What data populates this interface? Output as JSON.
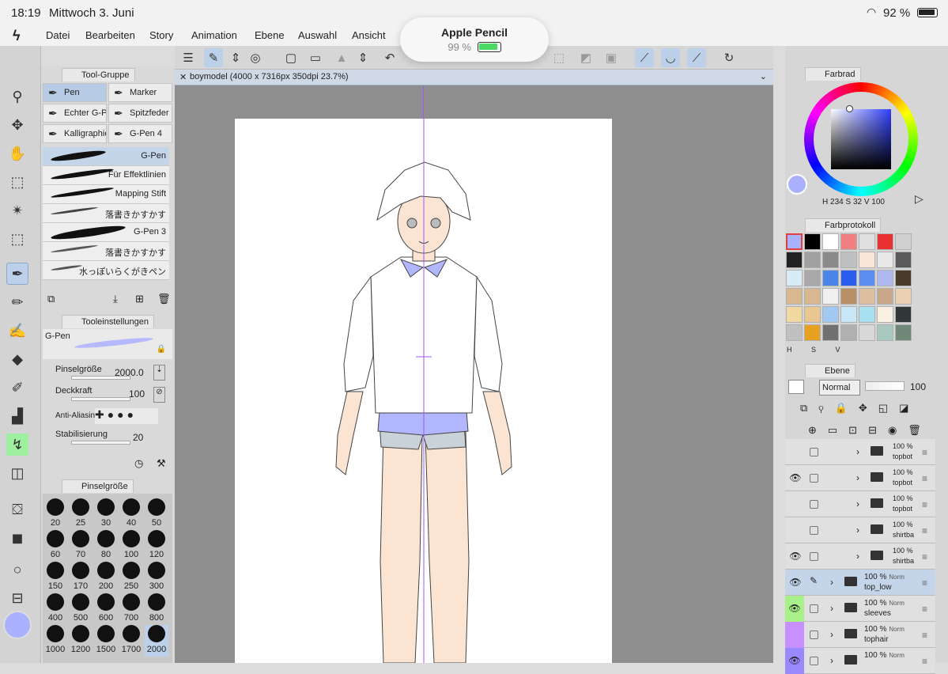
{
  "status": {
    "time": "18:19",
    "date": "Mittwoch 3. Juni",
    "battery": "92 %"
  },
  "menu": [
    "Datei",
    "Bearbeiten",
    "Story",
    "Animation",
    "Ebene",
    "Auswahl",
    "Ansicht"
  ],
  "toast": {
    "title": "Apple Pencil",
    "percent": "99 %",
    "level": 0.99
  },
  "tool_group": {
    "title": "Tool-Gruppe",
    "tools": [
      "Pen",
      "Marker",
      "Echter G-P",
      "Spitzfeder",
      "Kalligraphie",
      "G-Pen 4"
    ],
    "brushes": [
      "G-Pen",
      "Für Effektlinien",
      "Mapping Stift",
      "落書きかすかす",
      "G-Pen 3",
      "落書きかすかす",
      "水っぽいらくがきペン"
    ]
  },
  "tool_settings": {
    "title": "Tooleinstellungen",
    "brush_name": "G-Pen",
    "size_label": "Pinselgröße",
    "size_value": "2000.0",
    "opacity_label": "Deckkraft",
    "opacity_value": "100",
    "aa_label": "Anti-Aliasing",
    "stab_label": "Stabilisierung",
    "stab_value": "20"
  },
  "brush_size": {
    "title": "Pinselgröße",
    "sizes": [
      "20",
      "25",
      "30",
      "40",
      "50",
      "60",
      "70",
      "80",
      "100",
      "120",
      "150",
      "170",
      "200",
      "250",
      "300",
      "400",
      "500",
      "600",
      "700",
      "800",
      "1000",
      "1200",
      "1500",
      "1700",
      "2000"
    ]
  },
  "document": {
    "title": "boymodel (4000 x 7316px 350dpi 23.7%)"
  },
  "color_wheel": {
    "title": "Farbrad",
    "h_label": "H",
    "h": "234",
    "s_label": "S",
    "s": "32",
    "v_label": "V",
    "v": "100",
    "main_color": "#aab2ff"
  },
  "color_history": {
    "title": "Farbprotokoll",
    "colors": [
      "#aab2ff",
      "#000000",
      "#ffffff",
      "#f08080",
      "#e0e0e0",
      "#e83030",
      "#d0d0d0",
      "#222222",
      "#a0a0a0",
      "#8a8a8a",
      "#c0c0c0",
      "#f8e6d8",
      "#e8e8e8",
      "#5a5a5a",
      "#d8ecf8",
      "#a8a8a8",
      "#4a86e8",
      "#2a5cf0",
      "#5a8ef0",
      "#b0b8f0",
      "#4a3a2a",
      "#d8b890",
      "#d8b890",
      "#f0f0f0",
      "#b89068",
      "#dcc0a0",
      "#c8a888",
      "#e8d0b0",
      "#f0d8a0",
      "#e8c890",
      "#a0c8f0",
      "#c8e8f8",
      "#a8e0f0",
      "#f8f0e0",
      "#303838",
      "#c0c0c0",
      "#e8a020",
      "#707070",
      "#b0b0b0",
      "#d8d8d8",
      "#a8c8c0",
      "#708878"
    ],
    "labels": [
      "H",
      "S",
      "V"
    ]
  },
  "layers": {
    "title": "Ebene",
    "blend": "Normal",
    "opacity": "100",
    "rows": [
      {
        "pct": "100 %",
        "mode": "",
        "name": "topbot",
        "visible": false
      },
      {
        "pct": "100 %",
        "mode": "",
        "name": "topbot",
        "visible": true
      },
      {
        "pct": "100 %",
        "mode": "",
        "name": "topbot",
        "visible": false
      },
      {
        "pct": "100 %",
        "mode": "",
        "name": "shirtba",
        "visible": false
      },
      {
        "pct": "100 %",
        "mode": "",
        "name": "shirtba",
        "visible": true
      },
      {
        "pct": "100 %",
        "mode": "Norm",
        "name": "top_low",
        "visible": true
      },
      {
        "pct": "100 %",
        "mode": "Norm",
        "name": "sleeves",
        "visible": true
      },
      {
        "pct": "100 %",
        "mode": "Norm",
        "name": "tophair",
        "visible": false
      },
      {
        "pct": "100 %",
        "mode": "Norm",
        "name": "",
        "visible": true
      }
    ]
  }
}
